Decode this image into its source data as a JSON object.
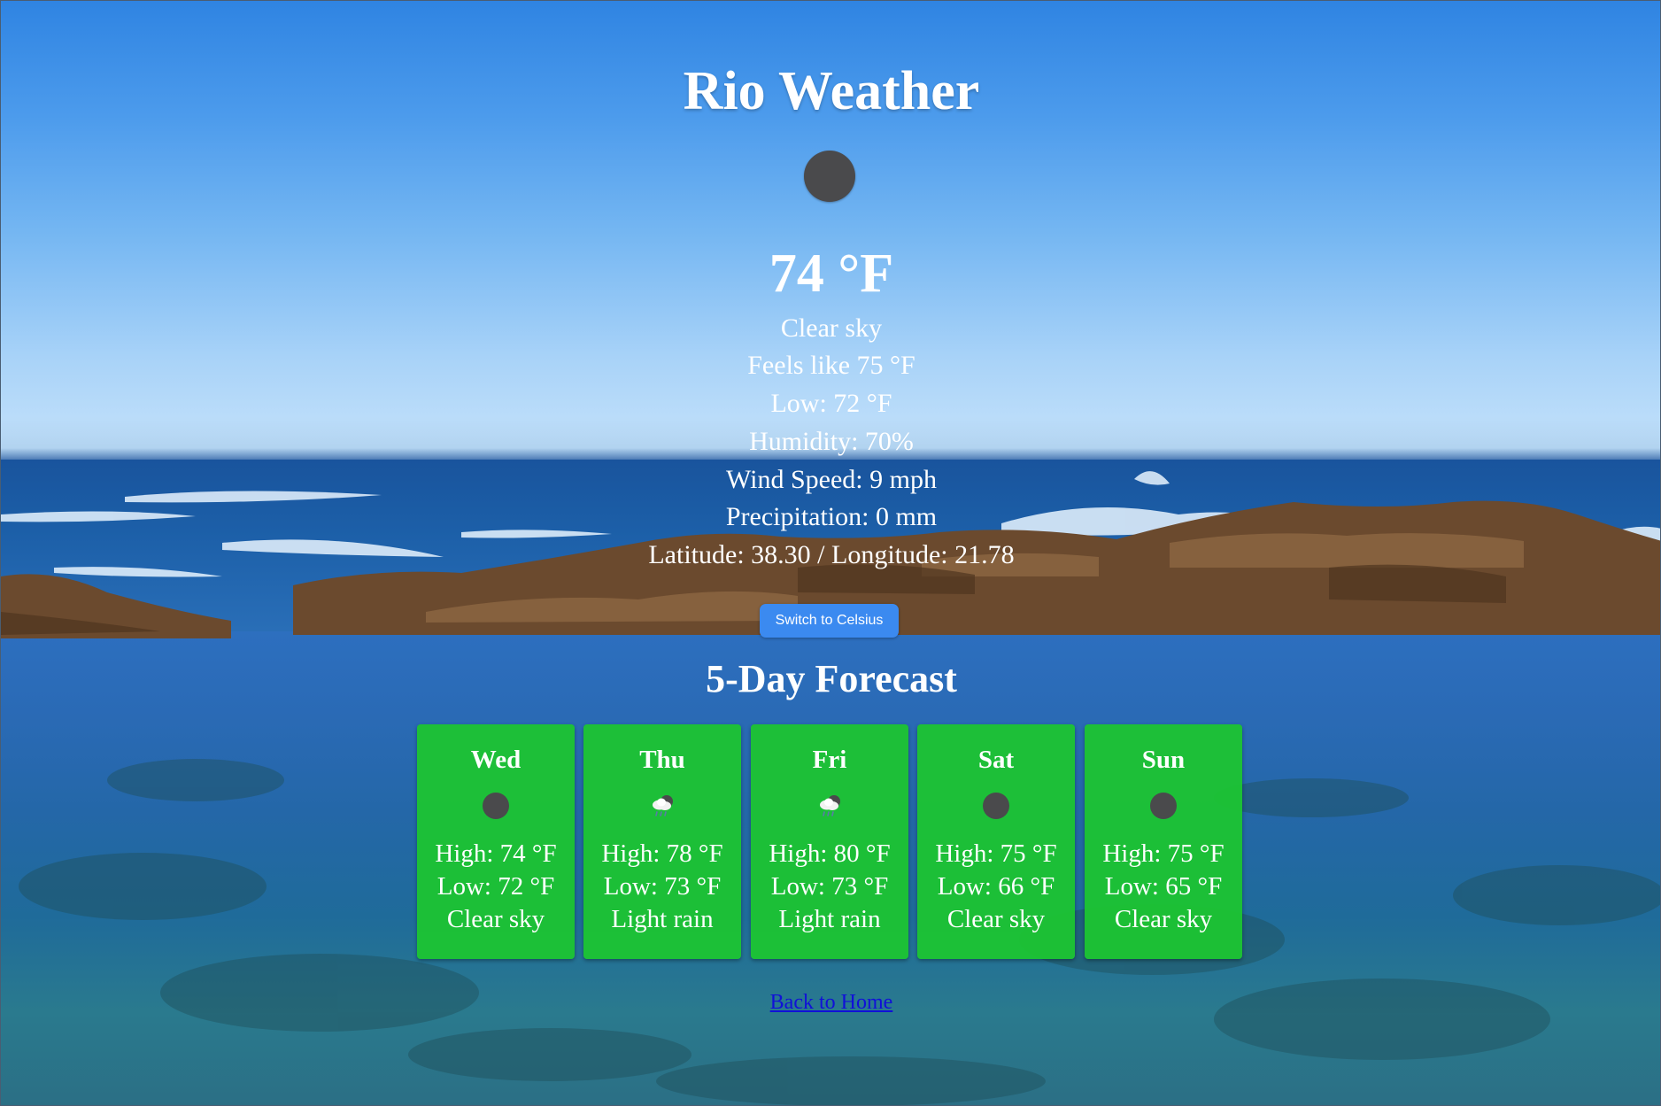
{
  "page": {
    "title": "Rio Weather"
  },
  "current": {
    "icon": "clear-sky-icon",
    "temperature": "74 °F",
    "description": "Clear sky",
    "feels_like": "Feels like 75 °F",
    "low": "Low: 72 °F",
    "humidity": "Humidity: 70%",
    "wind_speed": "Wind Speed: 9 mph",
    "precipitation": "Precipitation: 0 mm",
    "coordinates": "Latitude: 38.30 / Longitude: 21.78"
  },
  "controls": {
    "unit_toggle_label": "Switch to Celsius"
  },
  "forecast": {
    "heading": "5-Day Forecast",
    "days": [
      {
        "day": "Wed",
        "icon": "clear-sky-icon",
        "high": "High: 74 °F",
        "low": "Low: 72 °F",
        "condition": "Clear sky"
      },
      {
        "day": "Thu",
        "icon": "light-rain-icon",
        "high": "High: 78 °F",
        "low": "Low: 73 °F",
        "condition": "Light rain"
      },
      {
        "day": "Fri",
        "icon": "light-rain-icon",
        "high": "High: 80 °F",
        "low": "Low: 73 °F",
        "condition": "Light rain"
      },
      {
        "day": "Sat",
        "icon": "clear-sky-icon",
        "high": "High: 75 °F",
        "low": "Low: 66 °F",
        "condition": "Clear sky"
      },
      {
        "day": "Sun",
        "icon": "clear-sky-icon",
        "high": "High: 75 °F",
        "low": "Low: 65 °F",
        "condition": "Clear sky"
      }
    ]
  },
  "footer": {
    "back_link_label": "Back to Home"
  },
  "colors": {
    "card_background": "#1cc432",
    "button_background": "#3b8af0",
    "link": "#1010d8",
    "icon_dark": "#4a4a4c"
  }
}
